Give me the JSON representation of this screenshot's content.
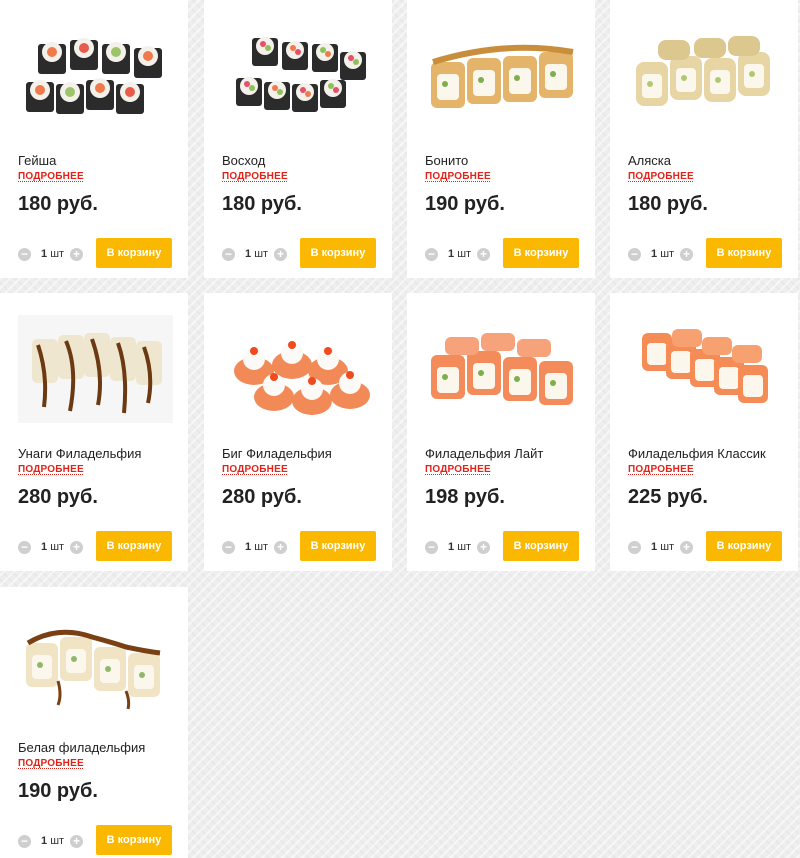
{
  "products": [
    {
      "name": "Гейша",
      "more": "ПОДРОБНЕЕ",
      "price": "180 руб.",
      "qty_num": "1",
      "qty_unit": "шт",
      "cart": "В корзину",
      "image": "sushi-rolls-nori"
    },
    {
      "name": "Восход",
      "more": "ПОДРОБНЕЕ",
      "price": "180 руб.",
      "qty_num": "1",
      "qty_unit": "шт",
      "cart": "В корзину",
      "image": "sushi-rolls-nori"
    },
    {
      "name": "Бонито",
      "more": "ПОДРОБНЕЕ",
      "price": "190 руб.",
      "qty_num": "1",
      "qty_unit": "шт",
      "cart": "В корзину",
      "image": "sushi-rolls-flakes"
    },
    {
      "name": "Аляска",
      "more": "ПОДРОБНЕЕ",
      "price": "180 руб.",
      "qty_num": "1",
      "qty_unit": "шт",
      "cart": "В корзину",
      "image": "sushi-rolls-flakes"
    },
    {
      "name": "Унаги Филадельфия",
      "more": "ПОДРОБНЕЕ",
      "price": "280 руб.",
      "qty_num": "1",
      "qty_unit": "шт",
      "cart": "В корзину",
      "image": "sushi-rolls-eel-sauce"
    },
    {
      "name": "Биг Филадельфия",
      "more": "ПОДРОБНЕЕ",
      "price": "280 руб.",
      "qty_num": "1",
      "qty_unit": "шт",
      "cart": "В корзину",
      "image": "sushi-rolls-cream-caviar"
    },
    {
      "name": "Филадельфия Лайт",
      "more": "ПОДРОБНЕЕ",
      "price": "198 руб.",
      "qty_num": "1",
      "qty_unit": "шт",
      "cart": "В корзину",
      "image": "sushi-rolls-salmon"
    },
    {
      "name": "Филадельфия Классик",
      "more": "ПОДРОБНЕЕ",
      "price": "225 руб.",
      "qty_num": "1",
      "qty_unit": "шт",
      "cart": "В корзину",
      "image": "sushi-rolls-salmon"
    },
    {
      "name": "Белая филадельфия",
      "more": "ПОДРОБНЕЕ",
      "price": "190 руб.",
      "qty_num": "1",
      "qty_unit": "шт",
      "cart": "В корзину",
      "image": "sushi-rolls-eel-sauce"
    }
  ],
  "icons": {
    "minus": "minus-icon",
    "plus": "plus-icon"
  },
  "colors": {
    "accent": "#fbb800",
    "link": "#e2231a",
    "card": "#ffffff",
    "background": "#eeeeee"
  }
}
